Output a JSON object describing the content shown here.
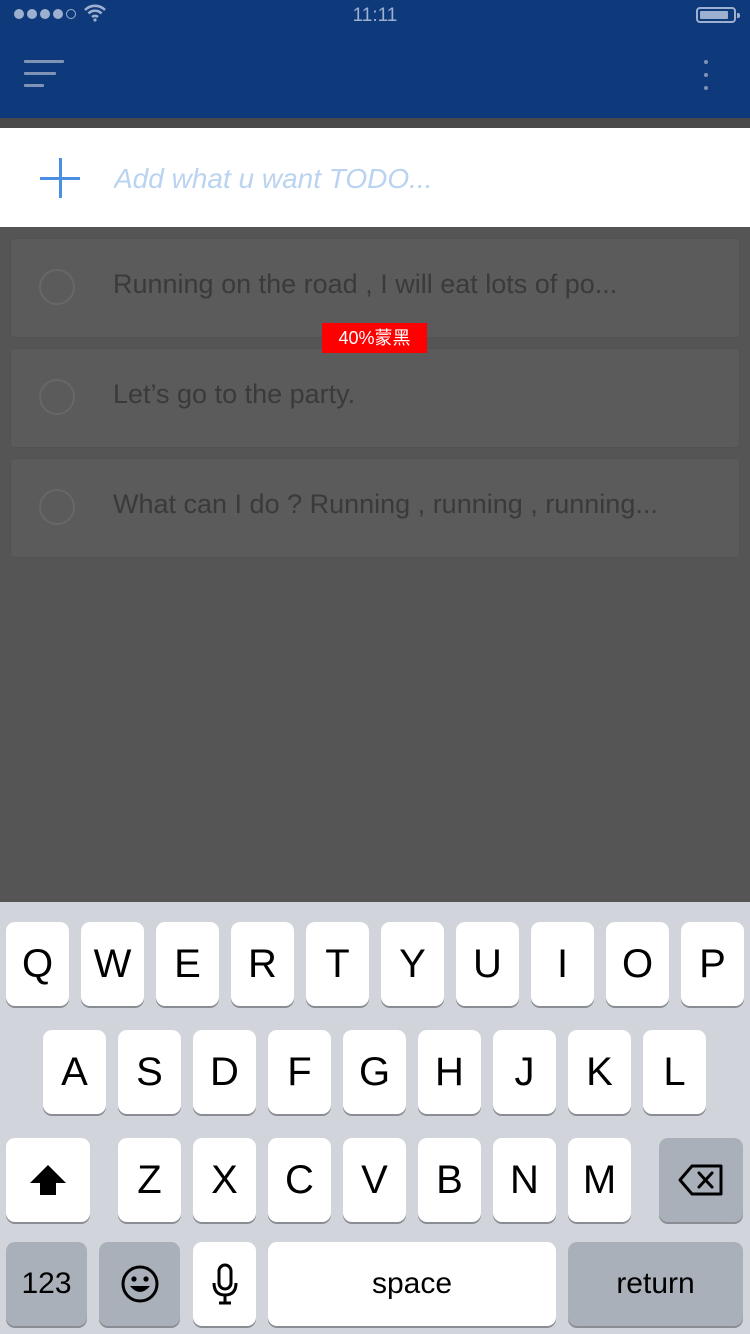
{
  "status_bar": {
    "time": "11:11"
  },
  "nav": {
    "menu_icon": "menu-icon",
    "more_icon": "more-vertical-icon"
  },
  "add_row": {
    "icon": "plus-icon",
    "placeholder": "Add what u want TODO..."
  },
  "todos": [
    {
      "text": "Running on the road , I will eat lots of po..."
    },
    {
      "text": "Let’s go to the party."
    },
    {
      "text": "What can I do ? Running , running , running..."
    }
  ],
  "overlay_label": "40%蒙黑",
  "colors": {
    "nav_bg": "#0e3a7c",
    "accent": "#4a90e2",
    "dim_overlay": "#555555",
    "label_bg": "#ff0000",
    "keyboard_bg": "#d1d5db"
  },
  "keyboard": {
    "row1": [
      "Q",
      "W",
      "E",
      "R",
      "T",
      "Y",
      "U",
      "I",
      "O",
      "P"
    ],
    "row2": [
      "A",
      "S",
      "D",
      "F",
      "G",
      "H",
      "J",
      "K",
      "L"
    ],
    "row3": [
      "Z",
      "X",
      "C",
      "V",
      "B",
      "N",
      "M"
    ],
    "numbers": "123",
    "space": "space",
    "return": "return",
    "shift_icon": "shift-icon",
    "delete_icon": "backspace-icon",
    "emoji_icon": "emoji-icon",
    "mic_icon": "microphone-icon"
  }
}
